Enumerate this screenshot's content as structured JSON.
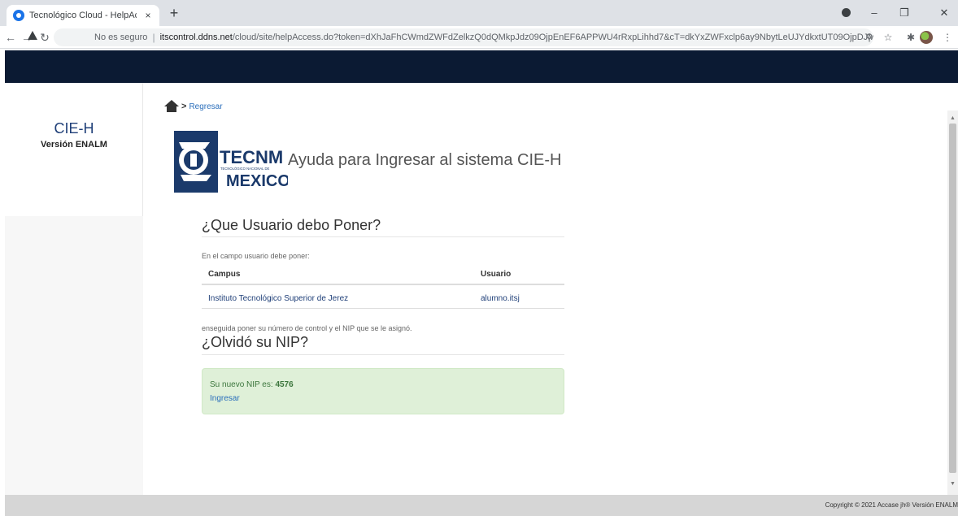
{
  "browser": {
    "tab_title": "Tecnológico Cloud - HelpAccess",
    "tab_close": "×",
    "new_tab": "+",
    "insecure_label": "No es seguro",
    "url_host": "itscontrol.ddns.net",
    "url_path": "/cloud/site/helpAccess.do?token=dXhJaFhCWmdZWFdZelkzQ0dQMkpJdz09OjpEnEF6APPWU4rRxpLihhd7&cT=dkYxZWFxclp6ay9NbytLeUJYdkxtUT09OjpDJMqP...",
    "icons": [
      "back-icon",
      "forward-icon",
      "reload-icon",
      "warning-icon",
      "zoom-icon",
      "star-icon",
      "extensions-icon",
      "profile-avatar",
      "menu-icon"
    ]
  },
  "sidebar": {
    "app_name": "CIE-H",
    "version": "Versión ENALM"
  },
  "breadcrumb": {
    "separator": ">",
    "back_link": "Regresar"
  },
  "logo": {
    "line1": "TECNM",
    "line2": "TECNOLÓGICO NACIONAL DE",
    "line3": "MEXICO"
  },
  "page_title": "Ayuda para Ingresar al sistema CIE-H",
  "usuario_section": {
    "heading": "¿Que Usuario debo Poner?",
    "hint": "En el campo usuario debe poner:",
    "columns": [
      "Campus",
      "Usuario"
    ],
    "rows": [
      {
        "campus": "Instituto Tecnológico Superior de Jerez",
        "usuario": "alumno.itsj"
      }
    ],
    "after_text": "enseguida poner su número de control y el NIP que se le asignó."
  },
  "nip_section": {
    "heading": "¿Olvidó su NIP?",
    "message_prefix": "Su nuevo NIP es:",
    "nip": "4576",
    "login_link": "Ingresar"
  },
  "footer": {
    "text": "Copyright © 2021 Accase jh® Versión ENALM"
  },
  "colors": {
    "topnav": "#0b1a33",
    "alert_bg": "#dff0d8",
    "link": "#2a6ebb",
    "app_name": "#1f3f78"
  }
}
